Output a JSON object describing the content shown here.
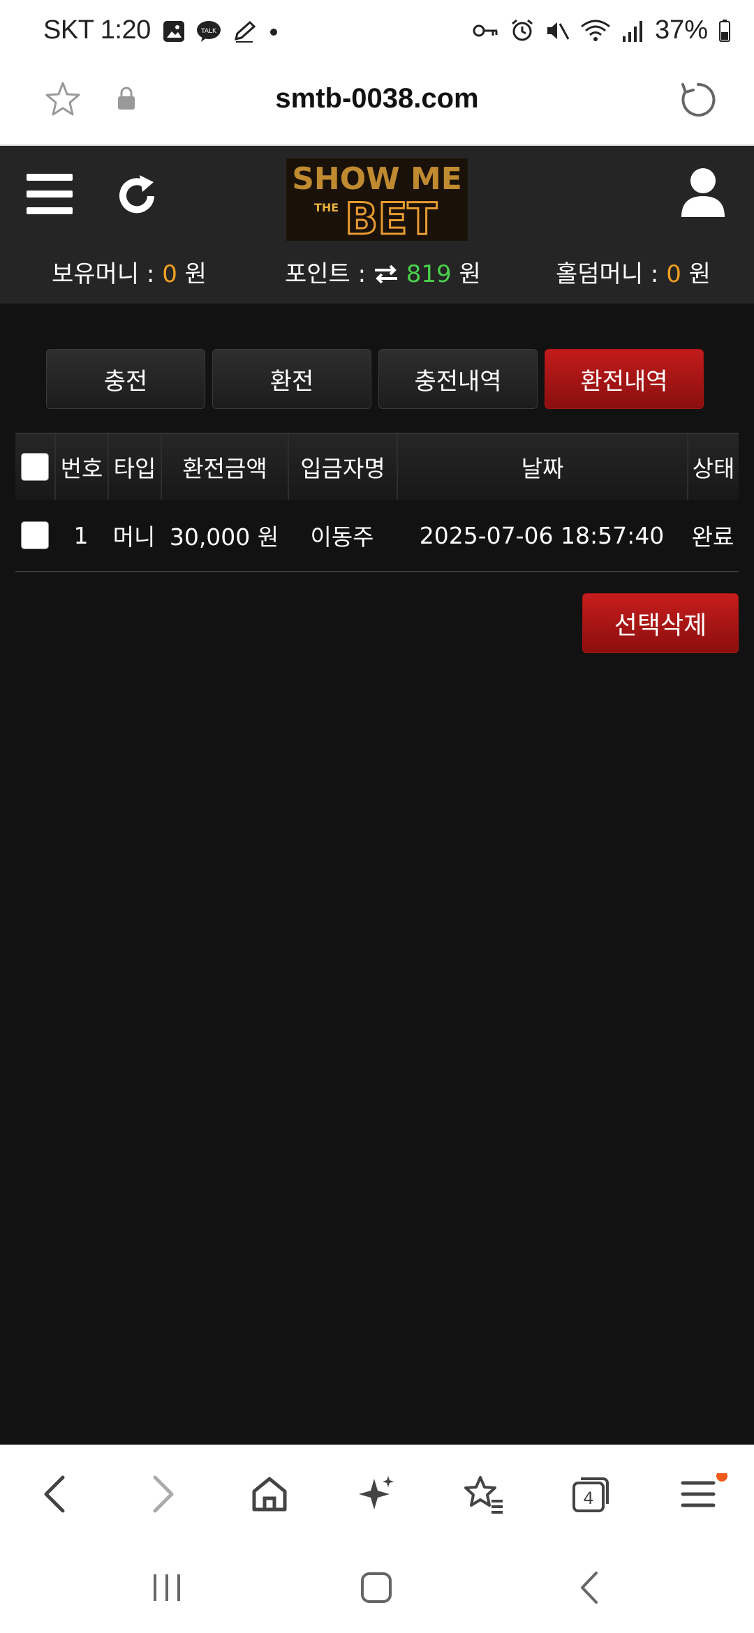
{
  "status_bar": {
    "time": "SKT 1:20",
    "battery": "37%"
  },
  "url_bar": {
    "url": "smtb-0038.com"
  },
  "header": {
    "logo_top": "SHOW ME",
    "logo_mid": "THE",
    "logo_bottom": "BET",
    "balances": {
      "money_label": "보유머니 :",
      "money_value": "0",
      "money_unit": "원",
      "point_label": "포인트 :",
      "point_value": "819",
      "point_unit": "원",
      "holdem_label": "홀덤머니 :",
      "holdem_value": "0",
      "holdem_unit": "원"
    }
  },
  "tabs": [
    {
      "label": "충전",
      "active": false
    },
    {
      "label": "환전",
      "active": false
    },
    {
      "label": "충전내역",
      "active": false
    },
    {
      "label": "환전내역",
      "active": true
    }
  ],
  "table": {
    "headers": [
      "번호",
      "타입",
      "환전금액",
      "입금자명",
      "날짜",
      "상태"
    ],
    "rows": [
      {
        "no": "1",
        "type": "머니",
        "amount": "30,000 원",
        "depositor": "이동주",
        "date": "2025-07-06 18:57:40",
        "status": "완료"
      }
    ]
  },
  "actions": {
    "delete_selected": "선택삭제"
  },
  "bottom_nav": {
    "tabs_count": "4"
  },
  "colors": {
    "accent_red": "#b01818",
    "orange": "#f0a020",
    "green": "#4cd04c"
  }
}
